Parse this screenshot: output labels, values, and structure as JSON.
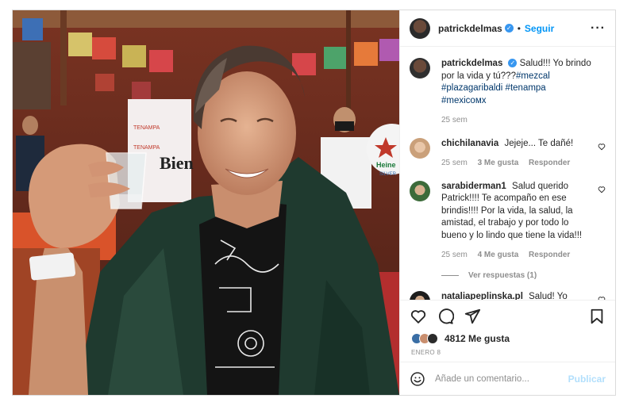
{
  "post": {
    "author": "patrickdelmas",
    "follow_label": "Seguir",
    "more_label": "···",
    "dot": "•"
  },
  "comments": [
    {
      "user": "patrickdelmas",
      "text": "Salud!!! Yo brindo por la vida y tú???",
      "tags": "#mezcal #plazagaribaldi #tenampa #mexicoмх",
      "time": "25 sem",
      "avatar_color": "#2f2f2f"
    },
    {
      "user": "chichilanavia",
      "text": "Jejeje... Te dañé!",
      "time": "25 sem",
      "likes": "3 Me gusta",
      "reply": "Responder",
      "avatar_color": "#caa07a"
    },
    {
      "user": "sarabiderman1",
      "text": "Salud querido Patrick!!!! Te acompaño en ese brindis!!!! Por la vida, la salud, la amistad, el trabajo y por todo lo bueno y lo lindo que tiene la vida!!!",
      "time": "25 sem",
      "likes": "4 Me gusta",
      "reply": "Responder",
      "avatar_color": "#3c6b3a",
      "view_replies": "Ver respuestas (1)"
    },
    {
      "user": "nataliapeplinska.pl",
      "text": "Salud! Yo brindo por los sueños! 😁😁😁❤️ Na",
      "avatar_color": "#1d1d1d"
    }
  ],
  "likes": {
    "count": "4812 Me gusta"
  },
  "date": "ENERO 8",
  "add_comment": {
    "placeholder": "Añade un comentario...",
    "publish": "Publicar"
  },
  "photo": {
    "sign_text": "Bien",
    "sign_brand": "TENAMPA",
    "heineken": "Heine",
    "silver": "SILVER"
  }
}
